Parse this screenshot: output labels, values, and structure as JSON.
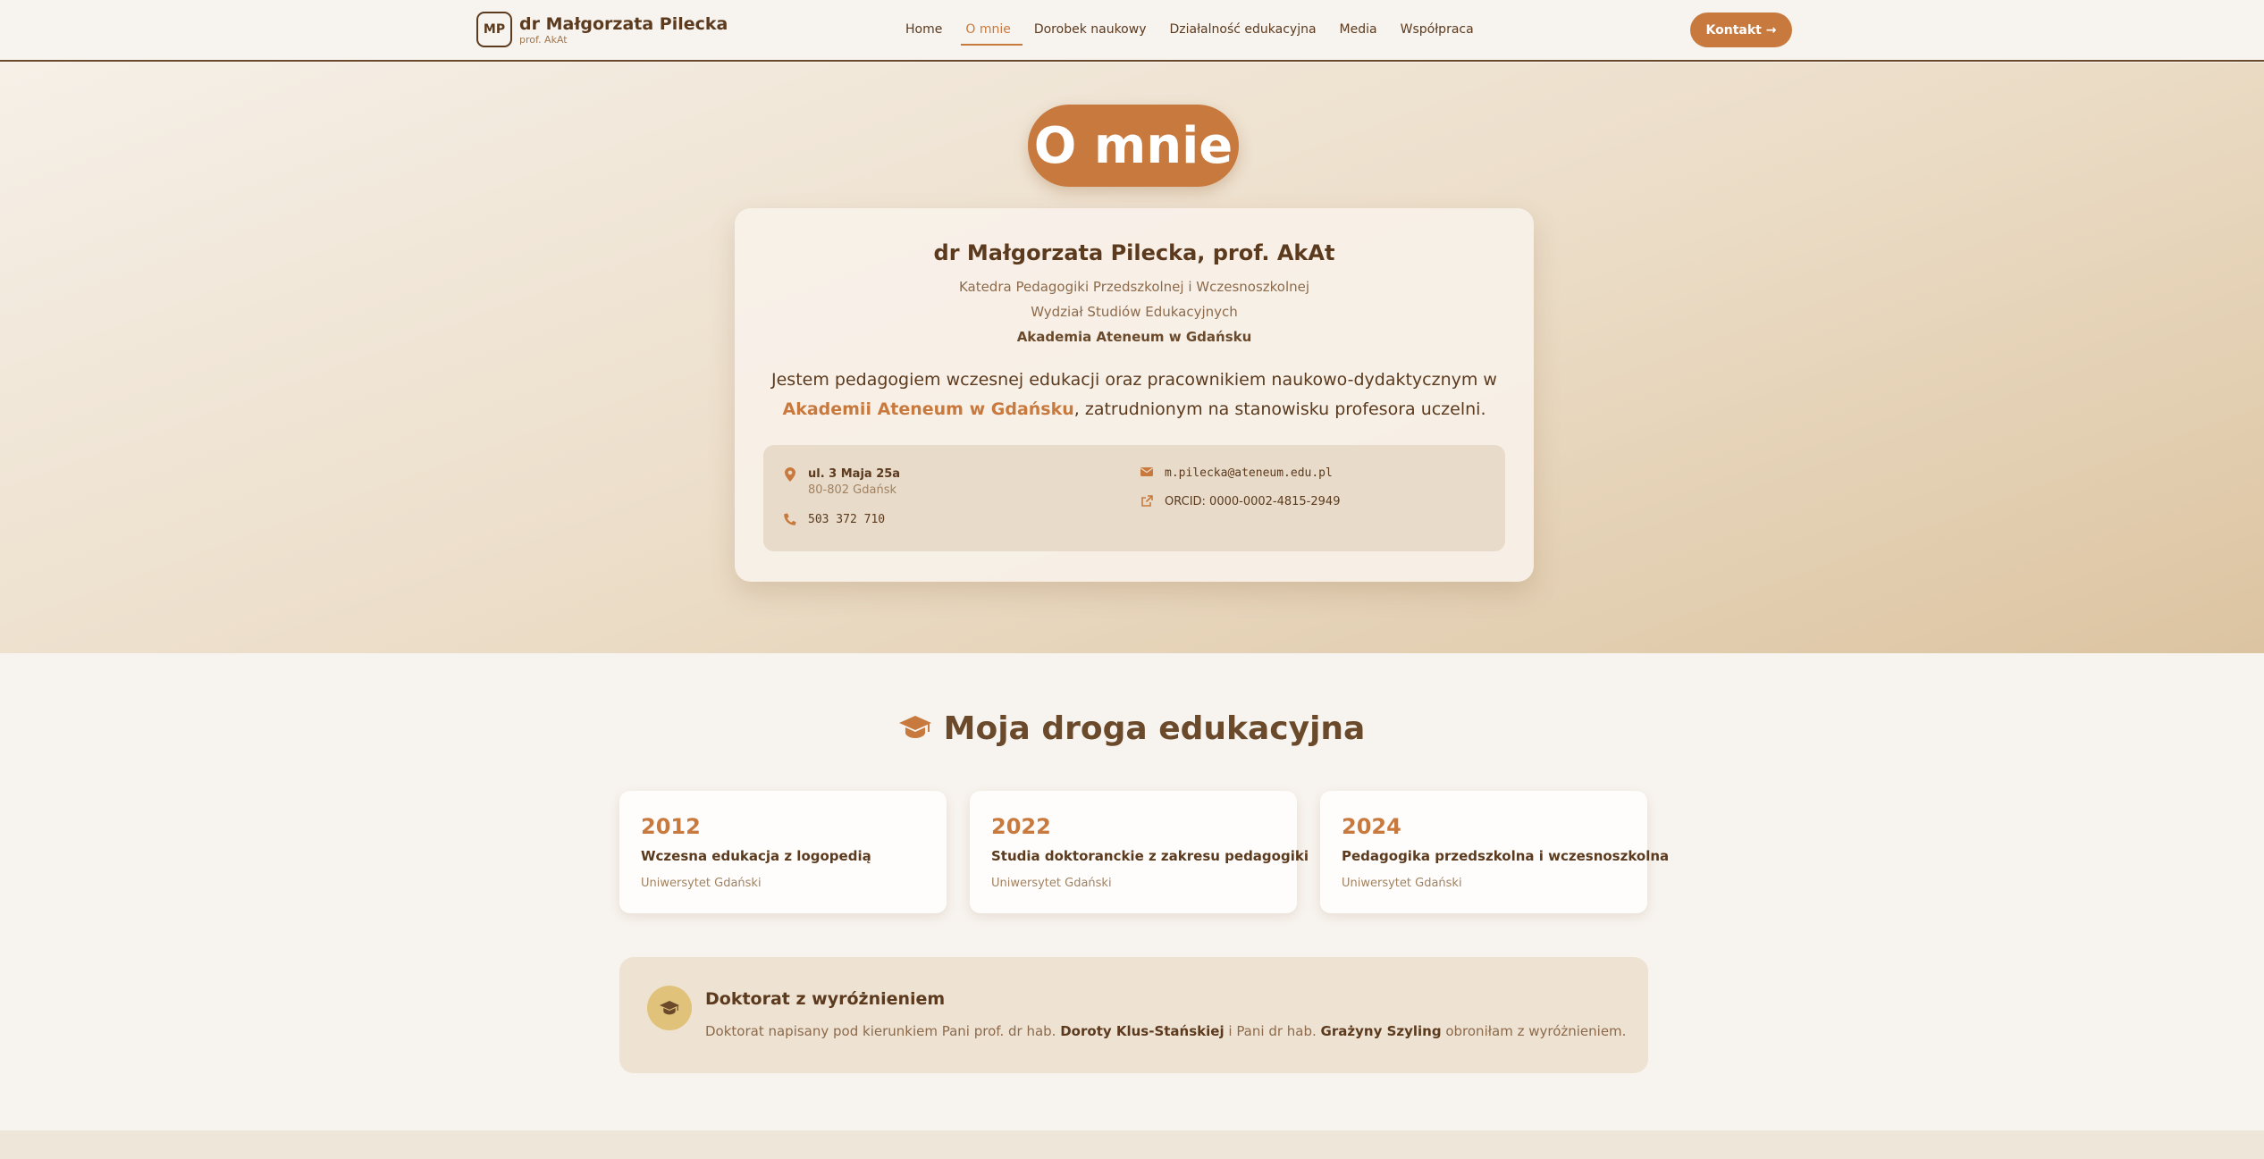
{
  "nav": {
    "logo_initials": "MP",
    "name": "dr Małgorzata Pilecka",
    "subtitle": "prof. AkAt",
    "items": [
      {
        "label": "Home"
      },
      {
        "label": "O mnie",
        "active": true
      },
      {
        "label": "Dorobek naukowy"
      },
      {
        "label": "Działalność edukacyjna"
      },
      {
        "label": "Media"
      },
      {
        "label": "Współpraca"
      }
    ],
    "cta_label": "Kontakt →"
  },
  "hero": {
    "title": "O mnie",
    "profile": {
      "name": "dr Małgorzata Pilecka, prof. AkAt",
      "dept": "Katedra Pedagogiki Przedszkolnej i Wczesnoszkolnej",
      "faculty": "Wydział Studiów Edukacyjnych",
      "university": "Akademia Ateneum w Gdańsku",
      "intro_pre": "Jestem pedagogiem wczesnej edukacji oraz pracownikiem naukowo-dydaktycznym w",
      "intro_highlight": "Akademii Ateneum w Gdańsku",
      "intro_post": ", zatrudnionym na stanowisku profesora uczelni."
    },
    "contact": {
      "street": "ul. 3 Maja 25a",
      "city": "80-802 Gdańsk",
      "phone": "503 372 710",
      "email": "m.pilecka@ateneum.edu.pl",
      "orcid": "ORCID: 0000-0002-4815-2949"
    }
  },
  "education": {
    "title": "Moja droga edukacyjna",
    "items": [
      {
        "year": "2012",
        "title": "Wczesna edukacja z logopedią",
        "school": "Uniwersytet Gdański"
      },
      {
        "year": "2022",
        "title": "Studia doktoranckie z zakresu pedagogiki",
        "school": "Uniwersytet Gdański"
      },
      {
        "year": "2024",
        "title": "Pedagogika przedszkolna i wczesnoszkolna",
        "school": "Uniwersytet Gdański"
      }
    ],
    "phd": {
      "title": "Doktorat z wyróżnieniem",
      "desc_1": "Doktorat napisany pod kierunkiem Pani prof. dr hab. ",
      "supervisor": "Doroty Klus-Stańskiej",
      "desc_2": " i Pani dr hab. ",
      "cosupervisor": "Grażyny Szyling",
      "desc_3": " obroniłam z wyróżnieniem."
    }
  },
  "colors": {
    "accent": "#c87a3e",
    "text": "#5b3a1e",
    "background": "#f7f3ee",
    "badge": "#e0c27a"
  }
}
